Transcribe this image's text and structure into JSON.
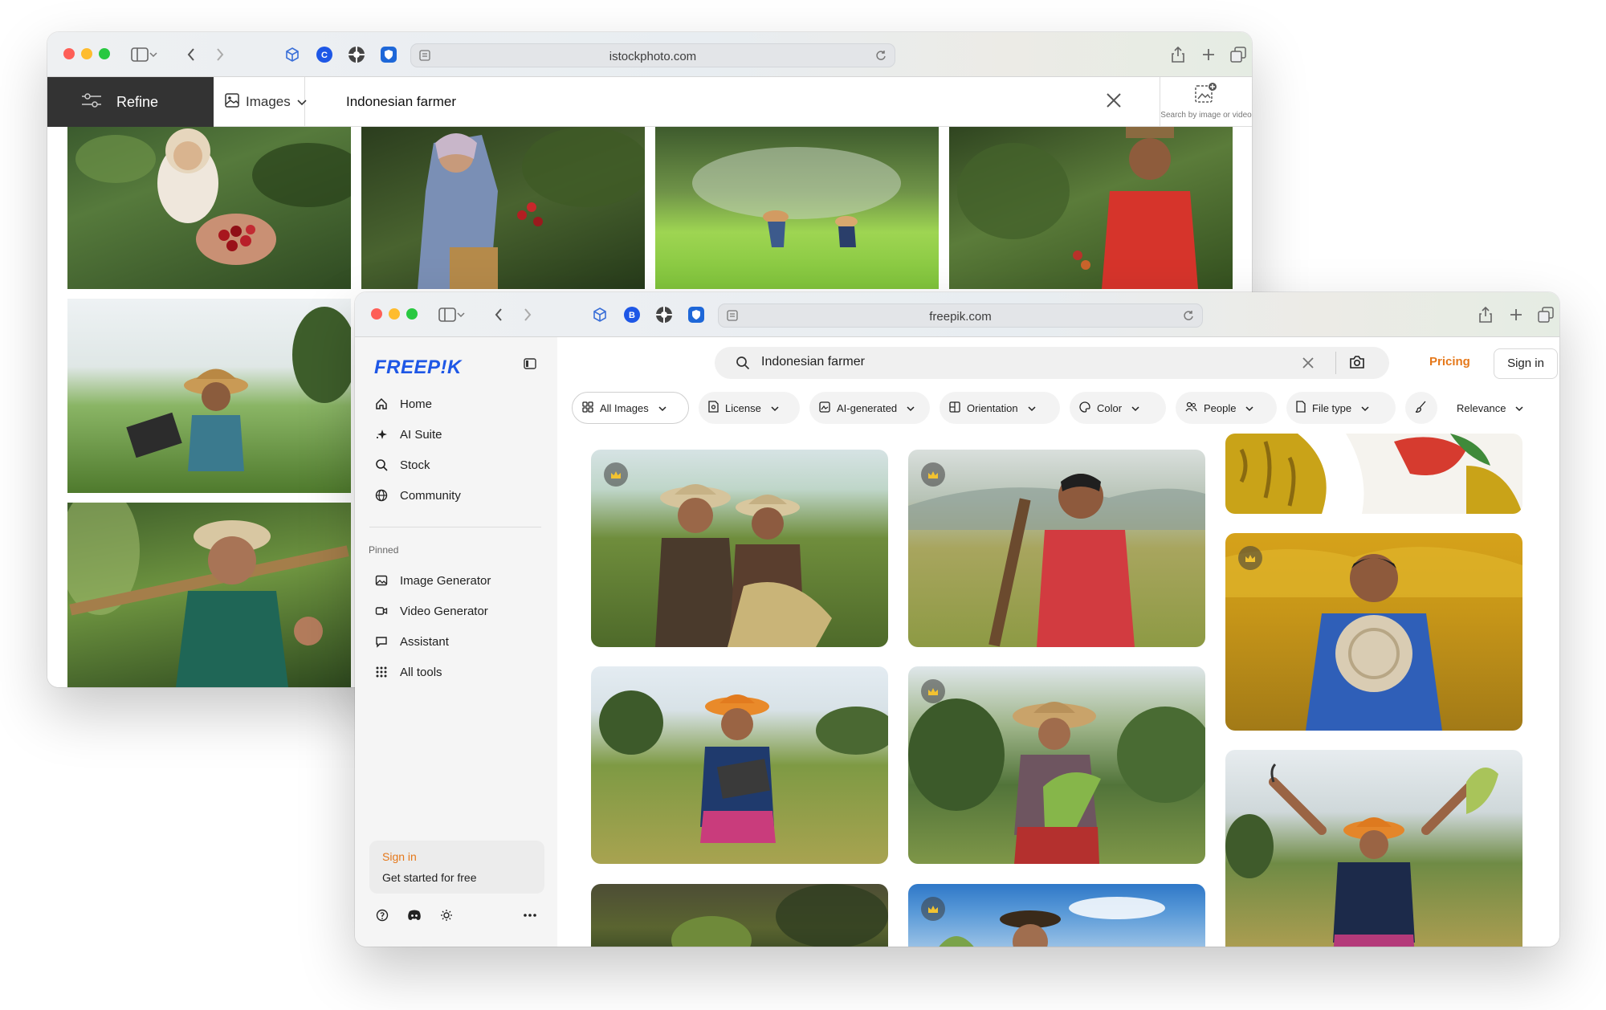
{
  "istock": {
    "url": "istockphoto.com",
    "refine_label": "Refine",
    "type_label": "Images",
    "query": "Indonesian farmer",
    "search_by_image_label": "Search by image or video"
  },
  "freepik": {
    "url": "freepik.com",
    "logo": "FREEP!K",
    "nav": [
      "Home",
      "AI Suite",
      "Stock",
      "Community"
    ],
    "pinned_label": "Pinned",
    "pinned": [
      "Image Generator",
      "Video Generator",
      "Assistant",
      "All tools"
    ],
    "signin_box": {
      "title": "Sign in",
      "subtitle": "Get started for free"
    },
    "query": "Indonesian farmer",
    "pricing_label": "Pricing",
    "signin_label": "Sign in",
    "filters": [
      "All Images",
      "License",
      "AI-generated",
      "Orientation",
      "Color",
      "People",
      "File type"
    ],
    "sort_label": "Relevance",
    "accent_color": "#1e57e6",
    "highlight_color": "#e5781a"
  }
}
